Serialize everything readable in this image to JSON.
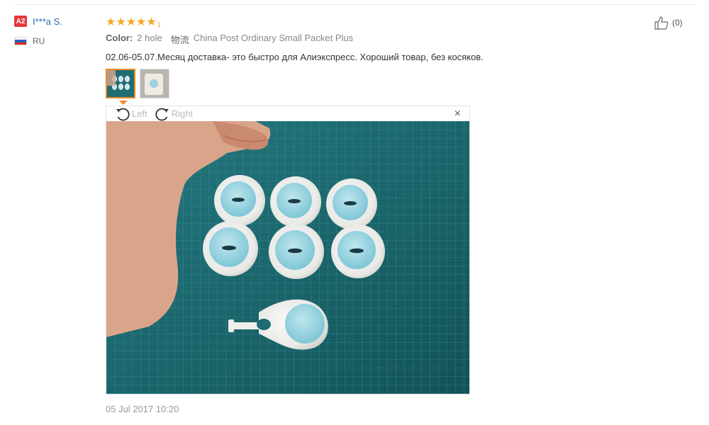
{
  "buyer": {
    "level": "A2",
    "name": "I***a S.",
    "country": "RU"
  },
  "review": {
    "rating": 5,
    "rating_suffix": "1",
    "color_label": "Color:",
    "color_value": "2 hole",
    "shipping_label": "物流",
    "shipping_value": "China Post Ordinary Small Packet Plus",
    "comment": "02.06-05.07.Месяц доставка- это быстро для Алиэкспресс. Хороший товар, без косяков.",
    "timestamp": "05 Jul 2017 10:20"
  },
  "viewer": {
    "rotate_left": "Left",
    "rotate_right": "Right",
    "close": "×"
  },
  "helpful": {
    "count": "(0)"
  },
  "colors": {
    "accent_orange": "#f08a24",
    "star": "#f6a623",
    "link_blue": "#2a6ab2",
    "badge_red": "#e4393c",
    "mat_teal": "#1e6e74"
  }
}
